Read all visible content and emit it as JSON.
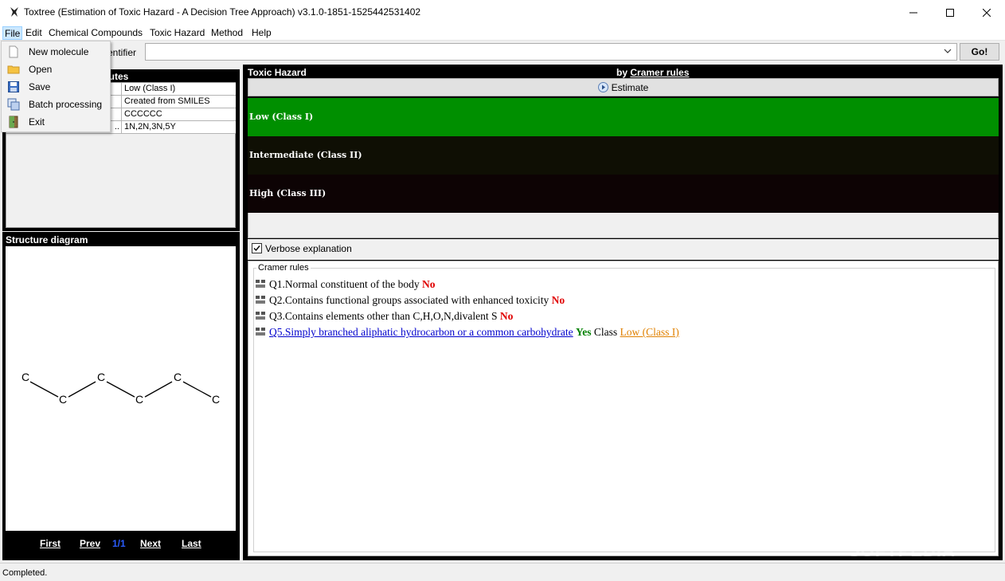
{
  "window": {
    "title": "Toxtree (Estimation of Toxic Hazard - A Decision Tree Approach) v3.1.0-1851-1525442531402"
  },
  "menubar": {
    "items": [
      {
        "label": "File",
        "key": "F"
      },
      {
        "label": "Edit",
        "key": "E"
      },
      {
        "label": "Chemical Compounds",
        "key": "C"
      },
      {
        "label": "Toxic Hazard",
        "key": "T"
      },
      {
        "label": "Method",
        "key": "M"
      },
      {
        "label": "Help",
        "key": "H"
      }
    ]
  },
  "file_menu": {
    "items": [
      {
        "label": "New molecule",
        "icon": "new-file-icon"
      },
      {
        "label": "Open",
        "icon": "folder-icon"
      },
      {
        "label": "Save",
        "icon": "save-icon"
      },
      {
        "label": "Batch processing",
        "icon": "batch-icon"
      },
      {
        "label": "Exit",
        "icon": "exit-door-icon"
      }
    ]
  },
  "identifier": {
    "label": "entifier",
    "value": "",
    "go_label": "Go!"
  },
  "attributes": {
    "header": "ibutes",
    "rows": [
      {
        "key": "",
        "value": "Low (Class I)"
      },
      {
        "key": "",
        "value": "Created from SMILES"
      },
      {
        "key": "",
        "value": "CCCCCC"
      },
      {
        "key": "..",
        "value": "1N,2N,3N,5Y"
      }
    ]
  },
  "structure": {
    "title": "Structure diagram",
    "atoms": [
      "C",
      "C",
      "C",
      "C",
      "C",
      "C"
    ]
  },
  "navigation": {
    "first": "First",
    "prev": "Prev",
    "page": "1/1",
    "next": "Next",
    "last": "Last"
  },
  "hazard": {
    "title": "Toxic Hazard",
    "by_prefix": "by",
    "by_link": "Cramer rules",
    "estimate_label": "Estimate",
    "classes": [
      {
        "label": "Low (Class I)",
        "color": "#008f00"
      },
      {
        "label": "Intermediate (Class II)",
        "color": "#0f0f04"
      },
      {
        "label": "High (Class III)",
        "color": "#0d0304"
      }
    ],
    "verbose_label": "Verbose explanation",
    "verbose_checked": true
  },
  "rules": {
    "legend": "Cramer rules",
    "items": [
      {
        "text": "Q1.Normal constituent of the body",
        "answer": "No"
      },
      {
        "text": "Q2.Contains functional groups associated with enhanced toxicity",
        "answer": "No"
      },
      {
        "text": "Q3.Contains elements other than C,H,O,N,divalent S",
        "answer": "No"
      },
      {
        "text": "Q5.Simply branched aliphatic hydrocarbon or a common carbohydrate",
        "answer": "Yes",
        "class_prefix": "Class",
        "class_value": "Low (Class I)"
      }
    ]
  },
  "status": {
    "text": "Completed."
  },
  "watermark": "SOFTPEDIA"
}
